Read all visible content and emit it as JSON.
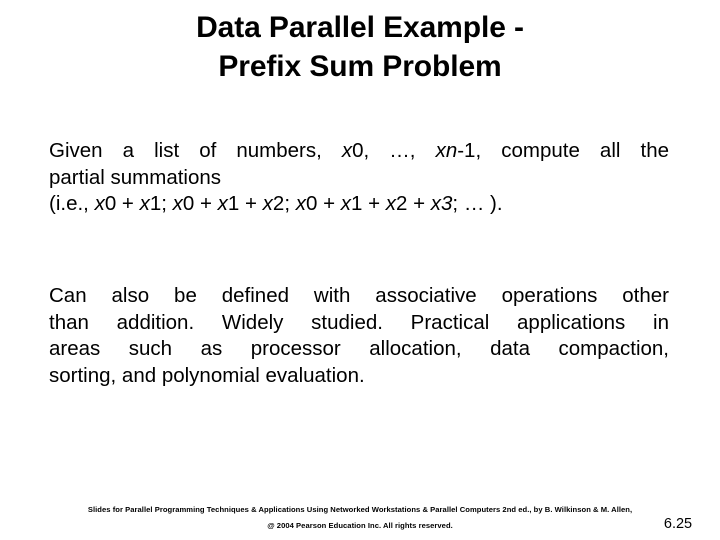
{
  "slide": {
    "background_color": "#ffffff",
    "text_color": "#000000",
    "page_number": "6.25"
  },
  "title": {
    "line1": "Data Parallel Example -",
    "line2": "Prefix Sum Problem",
    "full": "Data Parallel Example - Prefix Sum Problem"
  },
  "paragraph_one": {
    "full_text": "Given a list of numbers, x0, …, xn-1, compute all the partial summations (i.e., x0 + x1; x0 + x1 + x2; x0 + x1 + x2 + x3; … ).",
    "line1_a": "Given a list of numbers, ",
    "line1_var1": "x",
    "line1_b": "0, …, ",
    "line1_var2": "xn",
    "line1_c": "-1, compute all the",
    "line2": "partial summations",
    "line3_a": "(i.e., ",
    "line3_v1": "x",
    "line3_b": "0 + ",
    "line3_v2": "x",
    "line3_c": "1; ",
    "line3_v3": "x",
    "line3_d": "0 + ",
    "line3_v4": "x",
    "line3_e": "1 + ",
    "line3_v5": "x",
    "line3_f": "2; ",
    "line3_v6": "x",
    "line3_g": "0 + ",
    "line3_v7": "x",
    "line3_h": "1 + ",
    "line3_v8": "x",
    "line3_i": "2 + ",
    "line3_v9": "x",
    "line3_j": "3",
    "line3_k": "; … )."
  },
  "paragraph_two": {
    "full_text": "Can also be defined with associative operations other than addition. Widely studied. Practical applications in areas such as processor allocation, data compaction, sorting, and polynomial evaluation.",
    "line1": "Can also be defined with associative operations other",
    "line2": "than addition. Widely studied. Practical applications in",
    "line3": "areas such as processor allocation, data compaction,",
    "line4": "sorting, and polynomial evaluation."
  },
  "footer": {
    "credit": "Slides for Parallel Programming Techniques & Applications Using Networked Workstations & Parallel Computers 2nd ed., by B. Wilkinson & M. Allen,",
    "copyright": "@ 2004 Pearson Education Inc. All rights reserved."
  }
}
